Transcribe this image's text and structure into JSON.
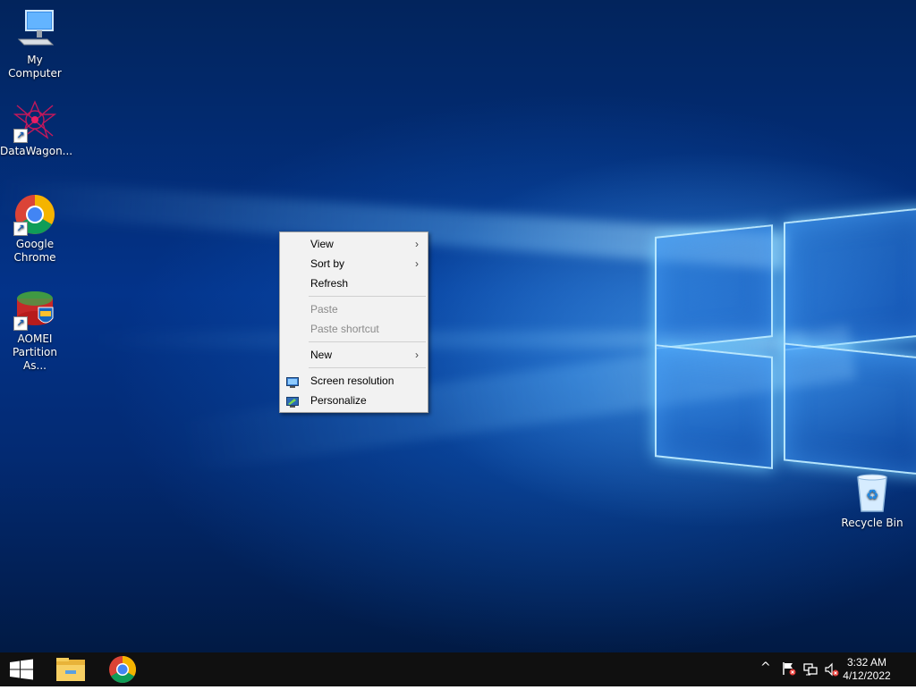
{
  "desktop": {
    "icons": [
      {
        "label": "My Computer"
      },
      {
        "label": "DataWagon..."
      },
      {
        "label_line1": "Google",
        "label_line2": "Chrome"
      },
      {
        "label_line1": "AOMEI",
        "label_line2": "Partition As..."
      },
      {
        "label": "Recycle Bin"
      }
    ]
  },
  "context_menu": {
    "items": [
      {
        "label": "View",
        "submenu": true
      },
      {
        "label": "Sort by",
        "submenu": true
      },
      {
        "label": "Refresh"
      },
      {
        "label": "Paste",
        "disabled": true
      },
      {
        "label": "Paste shortcut",
        "disabled": true
      },
      {
        "label": "New",
        "submenu": true
      },
      {
        "label": "Screen resolution",
        "icon": "monitor-icon"
      },
      {
        "label": "Personalize",
        "icon": "personalize-icon"
      }
    ]
  },
  "taskbar": {
    "pinned": [
      {
        "icon": "windows-start-icon"
      },
      {
        "icon": "file-explorer-icon"
      },
      {
        "icon": "chrome-icon"
      }
    ],
    "tray": {
      "icons": [
        "chevron-up-icon",
        "action-center-flag-icon",
        "network-icon",
        "volume-muted-icon"
      ],
      "time": "3:32 AM",
      "date": "4/12/2022"
    }
  },
  "colors": {
    "taskbar": "#101010",
    "menu_bg": "#f2f2f2",
    "wallpaper_blue": "#03338a"
  }
}
